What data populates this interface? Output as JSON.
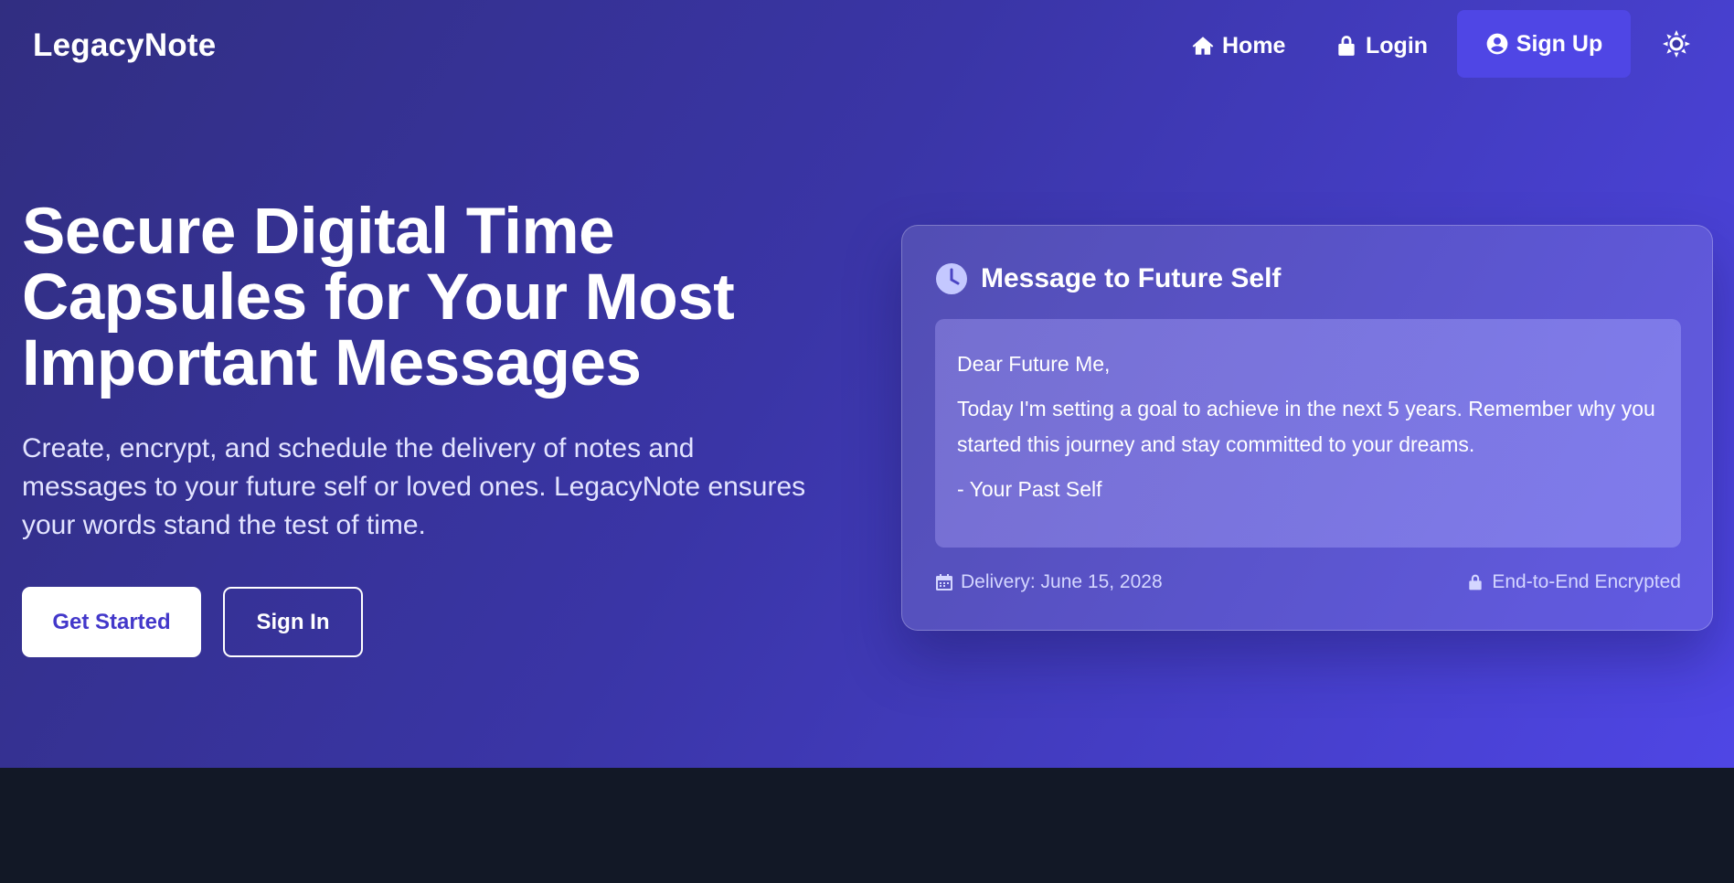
{
  "nav": {
    "brand": "LegacyNote",
    "home_label": "Home",
    "login_label": "Login",
    "signup_label": "Sign Up",
    "icons": {
      "home": "home-icon",
      "login": "lock-icon",
      "signup": "user-circle-icon",
      "theme": "sun-icon"
    }
  },
  "hero": {
    "headline": "Secure Digital Time Capsules for Your Most Important Messages",
    "subtext": "Create, encrypt, and schedule the delivery of notes and messages to your future self or loved ones. LegacyNote ensures your words stand the test of time.",
    "primary_button": "Get Started",
    "secondary_button": "Sign In"
  },
  "card": {
    "title": "Message to Future Self",
    "greeting": "Dear Future Me,",
    "body": "Today I'm setting a goal to achieve in the next 5 years. Remember why you started this journey and stay committed to your dreams.",
    "signature": "- Your Past Self",
    "delivery": "Delivery: June 15, 2028",
    "encryption": "End-to-End Encrypted"
  },
  "colors": {
    "hero_gradient_start": "#312e81",
    "hero_gradient_end": "#4f46e5",
    "signup_bg": "#4f46e5",
    "primary_button_text": "#4338ca",
    "footer_band": "#121826"
  }
}
